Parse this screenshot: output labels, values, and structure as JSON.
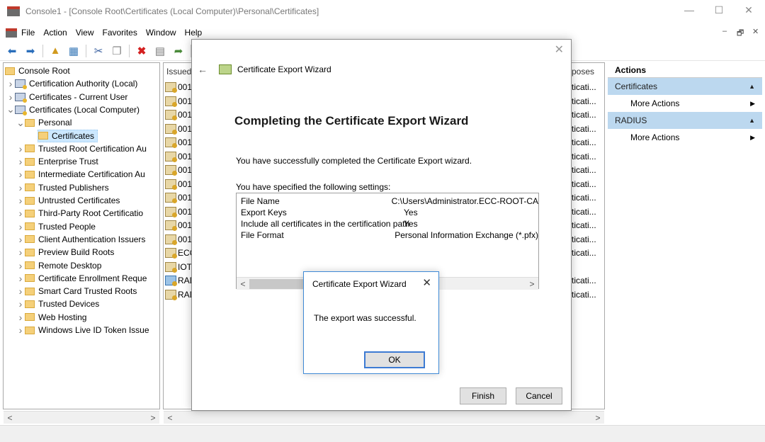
{
  "window": {
    "title": "Console1 - [Console Root\\Certificates (Local Computer)\\Personal\\Certificates]",
    "minimize": "—",
    "maximize": "☐",
    "close": "✕"
  },
  "menu": {
    "items": [
      "File",
      "Action",
      "View",
      "Favorites",
      "Window",
      "Help"
    ],
    "mdi_min": "–",
    "mdi_restore": "🗗",
    "mdi_close": "✕"
  },
  "toolbar": {
    "icons": [
      "back-arrow-icon",
      "forward-arrow-icon",
      "up-folder-icon",
      "show-hide-tree-icon",
      "cut-icon",
      "copy-icon",
      "delete-icon",
      "properties-icon",
      "export-list-icon",
      "help-icon"
    ]
  },
  "tree": {
    "items": [
      {
        "label": "Console Root",
        "indent": 0,
        "twisty": "",
        "icon": "folder"
      },
      {
        "label": "Certification Authority (Local)",
        "indent": 1,
        "twisty": ">",
        "icon": "cert"
      },
      {
        "label": "Certificates - Current User",
        "indent": 1,
        "twisty": ">",
        "icon": "cert"
      },
      {
        "label": "Certificates (Local Computer)",
        "indent": 1,
        "twisty": "v",
        "icon": "cert"
      },
      {
        "label": "Personal",
        "indent": 2,
        "twisty": "v",
        "icon": "folder"
      },
      {
        "label": "Certificates",
        "indent": 3,
        "twisty": "",
        "icon": "folder",
        "selected": true
      },
      {
        "label": "Trusted Root Certification Au",
        "indent": 2,
        "twisty": ">",
        "icon": "folder"
      },
      {
        "label": "Enterprise Trust",
        "indent": 2,
        "twisty": ">",
        "icon": "folder"
      },
      {
        "label": "Intermediate Certification Au",
        "indent": 2,
        "twisty": ">",
        "icon": "folder"
      },
      {
        "label": "Trusted Publishers",
        "indent": 2,
        "twisty": ">",
        "icon": "folder"
      },
      {
        "label": "Untrusted Certificates",
        "indent": 2,
        "twisty": ">",
        "icon": "folder"
      },
      {
        "label": "Third-Party Root Certificatio",
        "indent": 2,
        "twisty": ">",
        "icon": "folder"
      },
      {
        "label": "Trusted People",
        "indent": 2,
        "twisty": ">",
        "icon": "folder"
      },
      {
        "label": "Client Authentication Issuers",
        "indent": 2,
        "twisty": ">",
        "icon": "folder"
      },
      {
        "label": "Preview Build Roots",
        "indent": 2,
        "twisty": ">",
        "icon": "folder"
      },
      {
        "label": "Remote Desktop",
        "indent": 2,
        "twisty": ">",
        "icon": "folder"
      },
      {
        "label": "Certificate Enrollment Reque",
        "indent": 2,
        "twisty": ">",
        "icon": "folder"
      },
      {
        "label": "Smart Card Trusted Roots",
        "indent": 2,
        "twisty": ">",
        "icon": "folder"
      },
      {
        "label": "Trusted Devices",
        "indent": 2,
        "twisty": ">",
        "icon": "folder"
      },
      {
        "label": "Web Hosting",
        "indent": 2,
        "twisty": ">",
        "icon": "folder"
      },
      {
        "label": "Windows Live ID Token Issue",
        "indent": 2,
        "twisty": ">",
        "icon": "folder"
      }
    ],
    "scroll_left": "<",
    "scroll_right": ">"
  },
  "list": {
    "col_issued": "Issued T",
    "col_purposes": "poses",
    "rows": [
      {
        "issued": "0017",
        "purpose": "ticati..."
      },
      {
        "issued": "0017",
        "purpose": "ticati..."
      },
      {
        "issued": "0017",
        "purpose": "ticati..."
      },
      {
        "issued": "0017",
        "purpose": "ticati..."
      },
      {
        "issued": "0017",
        "purpose": "ticati..."
      },
      {
        "issued": "0017",
        "purpose": "ticati..."
      },
      {
        "issued": "0017",
        "purpose": "ticati..."
      },
      {
        "issued": "0017",
        "purpose": "ticati..."
      },
      {
        "issued": "0017",
        "purpose": "ticati..."
      },
      {
        "issued": "0017",
        "purpose": "ticati..."
      },
      {
        "issued": "0017",
        "purpose": "ticati..."
      },
      {
        "issued": "0017",
        "purpose": "ticati..."
      },
      {
        "issued": "ECC",
        "purpose": "ticati..."
      },
      {
        "issued": "IOT-",
        "purpose": ""
      },
      {
        "issued": "RAD",
        "purpose": "ticati...",
        "blue": true
      },
      {
        "issued": "RAD",
        "purpose": "ticati..."
      }
    ],
    "scroll_left": "<",
    "scroll_right": ">"
  },
  "actions": {
    "title": "Actions",
    "sections": [
      {
        "name": "Certificates",
        "item": "More Actions"
      },
      {
        "name": "RADIUS",
        "item": "More Actions"
      }
    ],
    "collapse_glyph": "▲",
    "more_glyph": "▶"
  },
  "wizard": {
    "close": "✕",
    "back": "←",
    "title": "Certificate Export Wizard",
    "heading": "Completing the Certificate Export Wizard",
    "success_text": "You have successfully completed the Certificate Export wizard.",
    "settings_label": "You have specified the following settings:",
    "settings": [
      {
        "key": "File Name",
        "value": "C:\\Users\\Administrator.ECC-ROOT-CA"
      },
      {
        "key": "Export Keys",
        "value": "Yes"
      },
      {
        "key": "Include all certificates in the certification path",
        "value": "Yes"
      },
      {
        "key": "File Format",
        "value": "Personal Information Exchange (*.pfx)"
      }
    ],
    "scroll_left": "<",
    "scroll_right": ">",
    "finish": "Finish",
    "cancel": "Cancel"
  },
  "message": {
    "title": "Certificate Export Wizard",
    "close": "✕",
    "text": "The export was successful.",
    "ok": "OK"
  }
}
